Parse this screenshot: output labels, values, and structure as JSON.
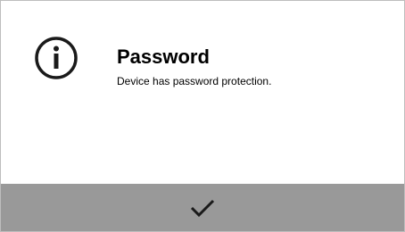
{
  "dialog": {
    "icon": "info-icon",
    "title": "Password",
    "message": "Device has password protection.",
    "confirm_icon": "checkmark-icon"
  },
  "colors": {
    "footer_background": "#999999",
    "icon_stroke": "#1a1a1a",
    "checkmark": "#1a1a1a"
  }
}
